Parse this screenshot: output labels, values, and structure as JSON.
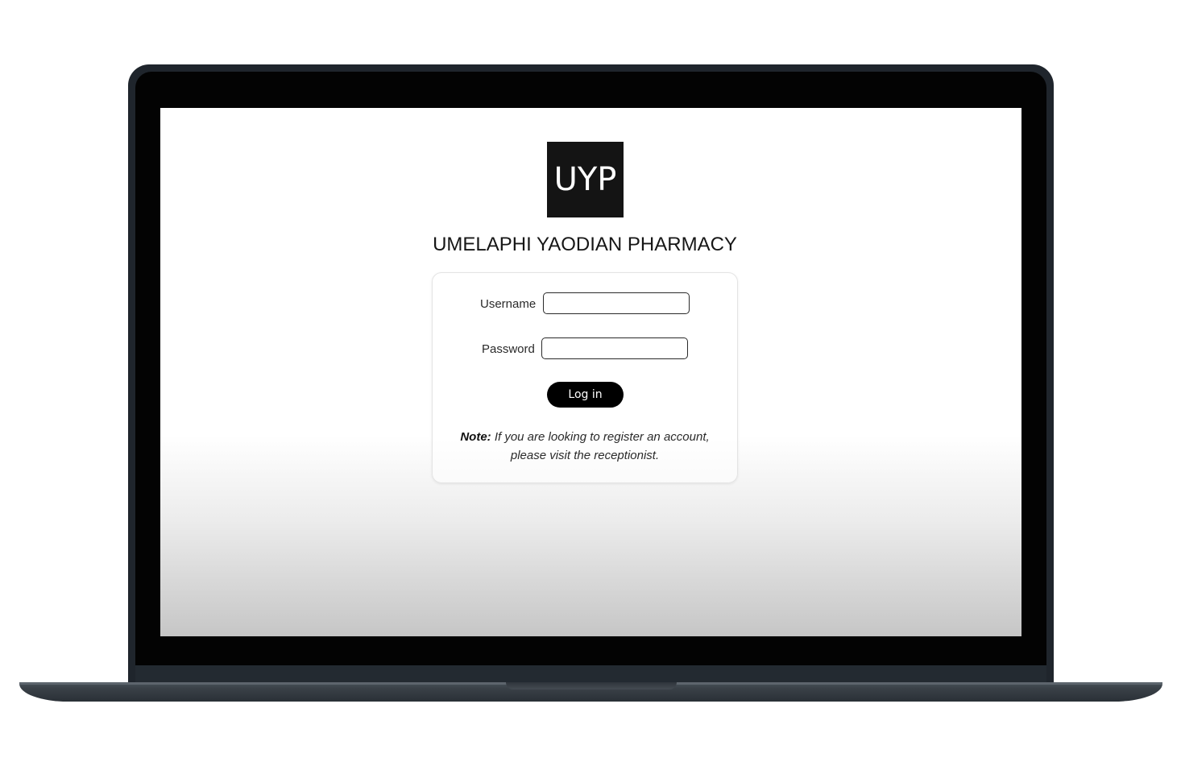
{
  "logo": {
    "text": "UYP"
  },
  "site": {
    "title": "UMELAPHI YAODIAN PHARMACY"
  },
  "login_form": {
    "username_label": "Username",
    "username_value": "",
    "password_label": "Password",
    "password_value": "",
    "submit_label": "Log in",
    "note_prefix": "Note:",
    "note_line1": "If you are looking to register an account,",
    "note_line2": "please visit the receptionist."
  },
  "colors": {
    "logo_background": "#141414",
    "button_background": "#000000",
    "device_frame": "#1f252c"
  }
}
